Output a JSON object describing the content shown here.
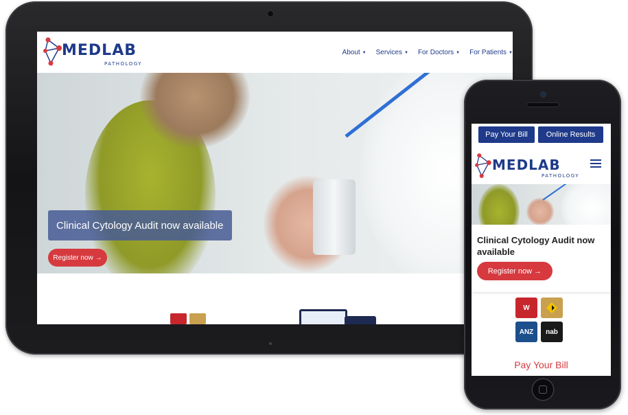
{
  "brand": {
    "name": "MEDLAB",
    "tagline": "PATHOLOGY",
    "primary_color": "#1f3a8a",
    "accent_color": "#d63a3f"
  },
  "tablet": {
    "nav": [
      {
        "label": "About"
      },
      {
        "label": "Services"
      },
      {
        "label": "For Doctors"
      },
      {
        "label": "For Patients"
      }
    ],
    "hero": {
      "caption": "Clinical Cytology Audit now available",
      "cta": "Register now →"
    }
  },
  "phone": {
    "top_buttons": [
      {
        "label": "Pay Your Bill"
      },
      {
        "label": "Online Results"
      }
    ],
    "menu_icon": "hamburger-icon",
    "hero": {
      "title": "Clinical Cytology Audit now available",
      "cta": "Register now →"
    },
    "banks": [
      {
        "name": "westpac",
        "text": "W",
        "color": "#c8262d"
      },
      {
        "name": "commbank",
        "text": "",
        "color": "#c9a04e"
      },
      {
        "name": "anz",
        "text": "ANZ",
        "color": "#1c4f8c"
      },
      {
        "name": "nab",
        "text": "nab",
        "color": "#1a1a1a"
      }
    ],
    "pay_bill_heading": "Pay Your Bill"
  }
}
